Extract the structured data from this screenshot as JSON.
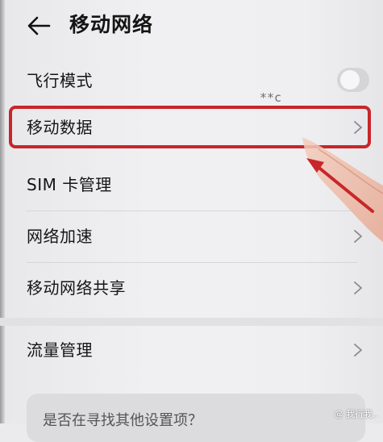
{
  "header": {
    "title": "移动网络"
  },
  "overlay_text": "**c",
  "items": [
    {
      "label": "飞行模式"
    },
    {
      "label": "移动数据"
    },
    {
      "label": "SIM 卡管理"
    },
    {
      "label": "网络加速"
    },
    {
      "label": "移动网络共享"
    },
    {
      "label": "流量管理"
    }
  ],
  "hint": {
    "text": "是否在寻找其他设置项？"
  },
  "watermark": "@ 我行我..",
  "colors": {
    "highlight": "#c8262a",
    "background": "#ebebed"
  }
}
